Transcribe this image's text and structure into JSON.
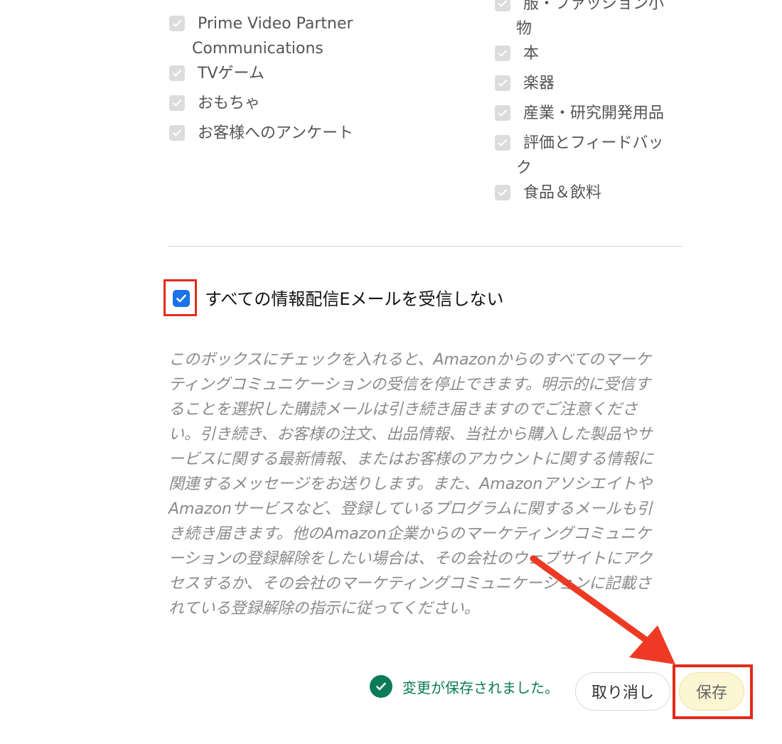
{
  "categories_left": [
    {
      "label": "Prime Video Partner",
      "label2": "Communications"
    },
    {
      "label": "TVゲーム"
    },
    {
      "label": "おもちゃ"
    },
    {
      "label": "お客様へのアンケート"
    }
  ],
  "categories_right": [
    {
      "label": "服・ファッション小",
      "label2": "物"
    },
    {
      "label": "本"
    },
    {
      "label": "楽器"
    },
    {
      "label": "産業・研究開発用品"
    },
    {
      "label": "評価とフィードバッ",
      "label2": "ク"
    },
    {
      "label": "食品＆飲料"
    }
  ],
  "optout": {
    "label": "すべての情報配信Eメールを受信しない",
    "checked": true
  },
  "notice_lines": [
    "このボックスにチェックを入れると、Amazonからのすべてのマーケ",
    "ティングコミュニケーションの受信を停止できます。明示的に受信す",
    "ることを選択した購読メールは引き続き届きますのでご注意くださ",
    "い。引き続き、お客様の注文、出品情報、当社から購入した製品やサ",
    "ービスに関する最新情報、またはお客様のアカウントに関する情報に",
    "関連するメッセージをお送りします。また、Amazonアソシエイトや",
    "Amazonサービスなど、登録しているプログラムに関するメールも引",
    "き続き届きます。他のAmazon企業からのマーケティングコミュニケ",
    "ーションの登録解除をしたい場合は、その会社のウェブサイトにアク",
    "セスするか、その会社のマーケティングコミュニケーションに記載さ",
    "れている登録解除の指示に従ってください。"
  ],
  "status": {
    "saved_text": "変更が保存されました。"
  },
  "buttons": {
    "cancel": "取り消し",
    "save": "保存"
  },
  "colors": {
    "highlight": "#e32b1a",
    "checkbox_checked": "#1a73e8",
    "success": "#0a7a58",
    "save_button_bg": "#fdf6d3"
  }
}
